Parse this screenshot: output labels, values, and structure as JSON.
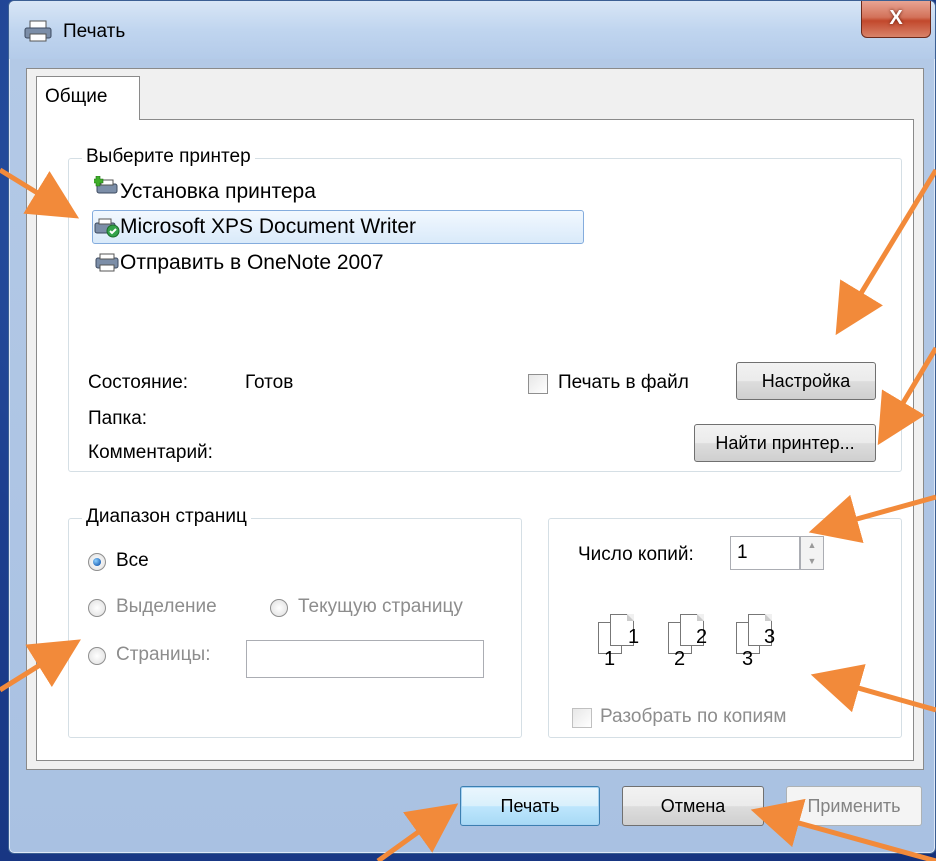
{
  "window": {
    "title": "Печать",
    "close_label": "X"
  },
  "tabs": [
    {
      "label": "Общие"
    }
  ],
  "printer_group": {
    "label": "Выберите принтер",
    "printers": [
      {
        "name": "Установка принтера"
      },
      {
        "name": "Microsoft XPS Document Writer"
      },
      {
        "name": "Отправить в OneNote 2007"
      }
    ],
    "status_label": "Состояние:",
    "status_value": "Готов",
    "folder_label": "Папка:",
    "comment_label": "Комментарий:",
    "print_to_file_label": "Печать в файл",
    "settings_button": "Настройка",
    "find_printer_button": "Найти принтер..."
  },
  "range_group": {
    "label": "Диапазон страниц",
    "all_label": "Все",
    "selection_label": "Выделение",
    "current_page_label": "Текущую страницу",
    "pages_label": "Страницы:",
    "pages_value": ""
  },
  "copies_group": {
    "copies_label": "Число копий:",
    "copies_value": "1",
    "collate_label": "Разобрать по копиям",
    "page_numbers": [
      "1",
      "1",
      "2",
      "2",
      "3",
      "3"
    ]
  },
  "footer": {
    "print_button": "Печать",
    "cancel_button": "Отмена",
    "apply_button": "Применить"
  },
  "colors": {
    "background": "#1d3f8f",
    "arrow": "#f28a3a",
    "selection": "#d9eafa"
  }
}
